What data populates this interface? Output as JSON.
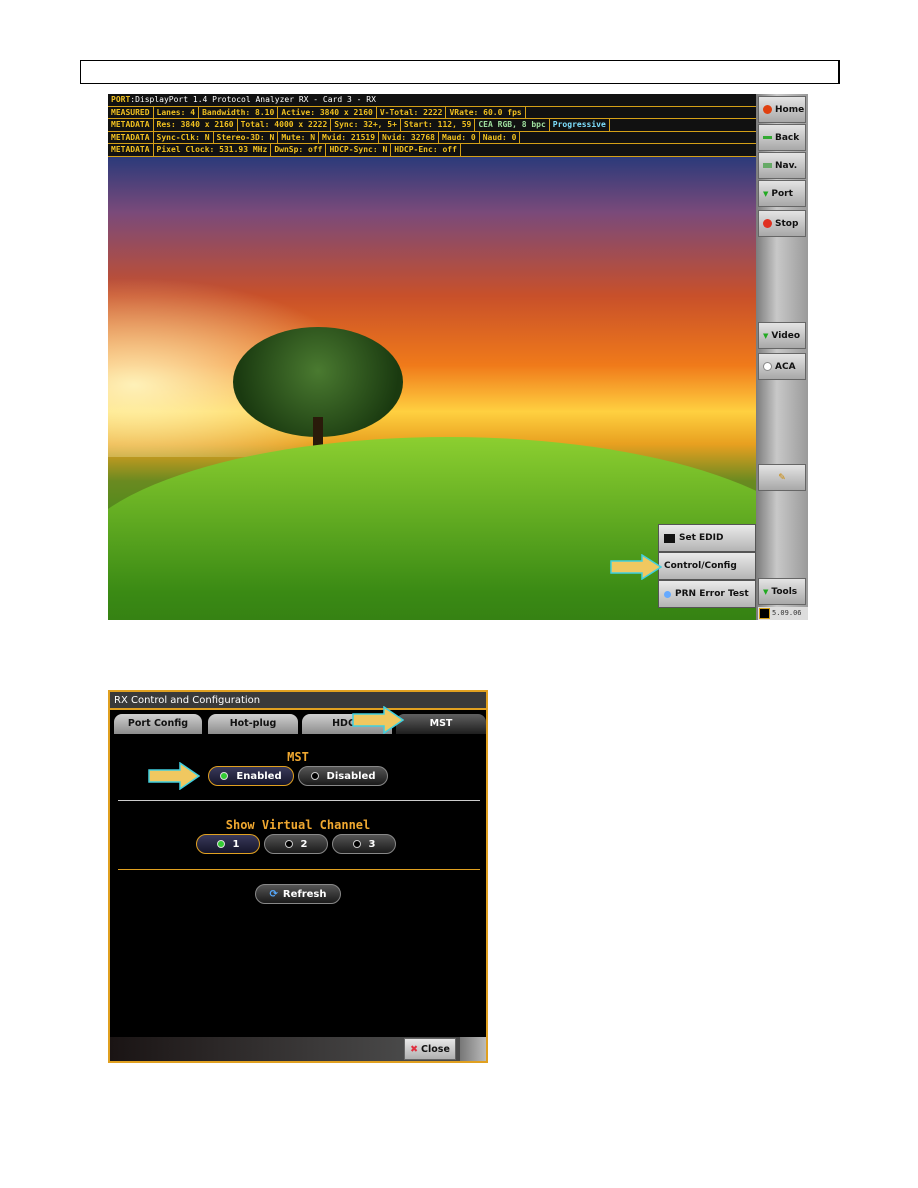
{
  "analyzer": {
    "port_row": {
      "label": "PORT",
      "value": ":DisplayPort 1.4 Protocol Analyzer RX - Card 3 - RX"
    },
    "measured_row": {
      "label": "MEASURED",
      "cells": [
        "Lanes: 4",
        "Bandwidth: 8.10",
        "Active: 3840 x 2160",
        "V-Total: 2222",
        "VRate: 60.0 fps"
      ]
    },
    "metadata_row_1": {
      "label": "METADATA",
      "cells": [
        "Res: 3840 x 2160",
        "Total: 4000 x 2222",
        "Sync: 32+, 5+",
        "Start: 112, 59",
        "CEA RGB, 8 bpc",
        "Progressive"
      ]
    },
    "metadata_row_2": {
      "label": "METADATA",
      "cells": [
        "Sync-Clk: N",
        "Stereo-3D: N",
        "Mute: N",
        "Mvid: 21519",
        "Nvid: 32768",
        "Maud: 0",
        "Naud: 0"
      ]
    },
    "metadata_row_3": {
      "label": "METADATA",
      "cells": [
        "Pixel Clock: 531.93 MHz",
        "DwnSp: off",
        "HDCP-Sync: N",
        "HDCP-Enc: off"
      ]
    },
    "sidebar": {
      "home": "Home",
      "back": "Back",
      "nav": "Nav.",
      "port": "Port",
      "stop": "Stop",
      "video": "Video",
      "aca": "ACA",
      "tools": "Tools",
      "version": "5.09.06"
    },
    "popup_menu": [
      "Set EDID",
      "Control/Config",
      "PRN Error Test"
    ],
    "set_edid_icon_text": "EDID"
  },
  "dialog": {
    "title": "RX Control and Configuration",
    "tabs": [
      {
        "label": "Port Config",
        "active": false
      },
      {
        "label": "Hot-plug",
        "active": false
      },
      {
        "label": "HDCP",
        "active": false
      },
      {
        "label": "MST",
        "active": true
      }
    ],
    "mst": {
      "heading": "MST",
      "options": [
        "Enabled",
        "Disabled"
      ],
      "selected": "Enabled"
    },
    "virtual_channel": {
      "heading": "Show Virtual Channel",
      "options": [
        "1",
        "2",
        "3"
      ],
      "selected": "1"
    },
    "refresh_label": "Refresh",
    "close_label": "Close"
  },
  "colors": {
    "accent": "#e0a020",
    "arrow_fill": "#f0c860",
    "arrow_border": "#40d0e0",
    "label_yellow": "#f0c020"
  }
}
